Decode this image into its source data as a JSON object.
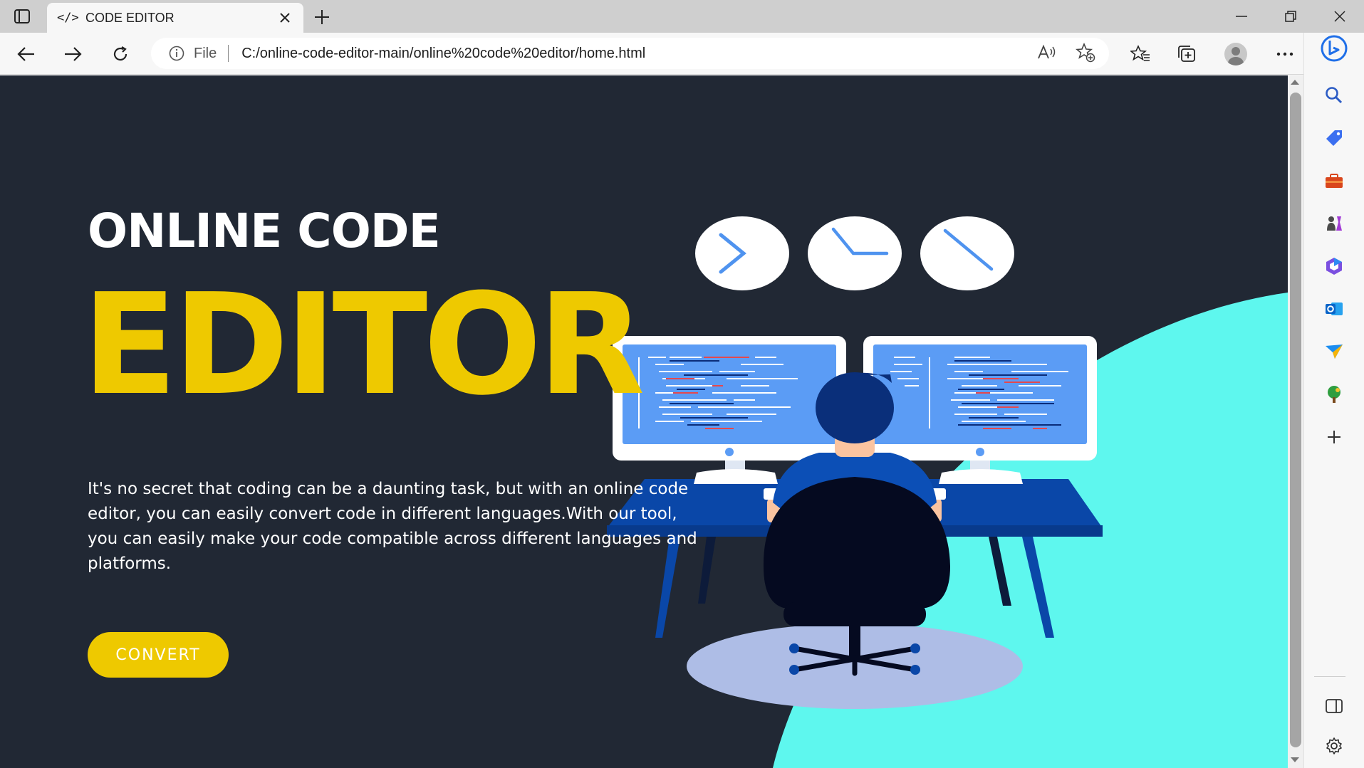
{
  "browser": {
    "tab_title": "CODE EDITOR",
    "tab_icon_glyph": "</>",
    "address": {
      "scheme_label": "File",
      "url": "C:/online-code-editor-main/online%20code%20editor/home.html"
    }
  },
  "page": {
    "headline_top": "ONLINE CODE",
    "headline_main": "EDITOR",
    "description": "It's no secret that coding can be a daunting task, but with an online code editor, you can easily convert code in different languages.With our tool, you can easily make your code compatible across different languages and platforms.",
    "cta_label": "CONVERT"
  },
  "colors": {
    "page_background": "#212834",
    "accent_yellow": "#eec900",
    "accent_cyan": "#5ef7ee",
    "monitor_screen": "#5b9cf5",
    "desk_blue": "#0a47a8",
    "floor_mat": "#aebde6"
  },
  "sidebar": {
    "items": [
      "search-icon",
      "tag-icon",
      "toolbox-icon",
      "games-icon",
      "office-icon",
      "outlook-icon",
      "send-icon",
      "tree-icon",
      "add-icon"
    ],
    "bottom_items": [
      "split-screen-icon",
      "settings-icon"
    ]
  }
}
